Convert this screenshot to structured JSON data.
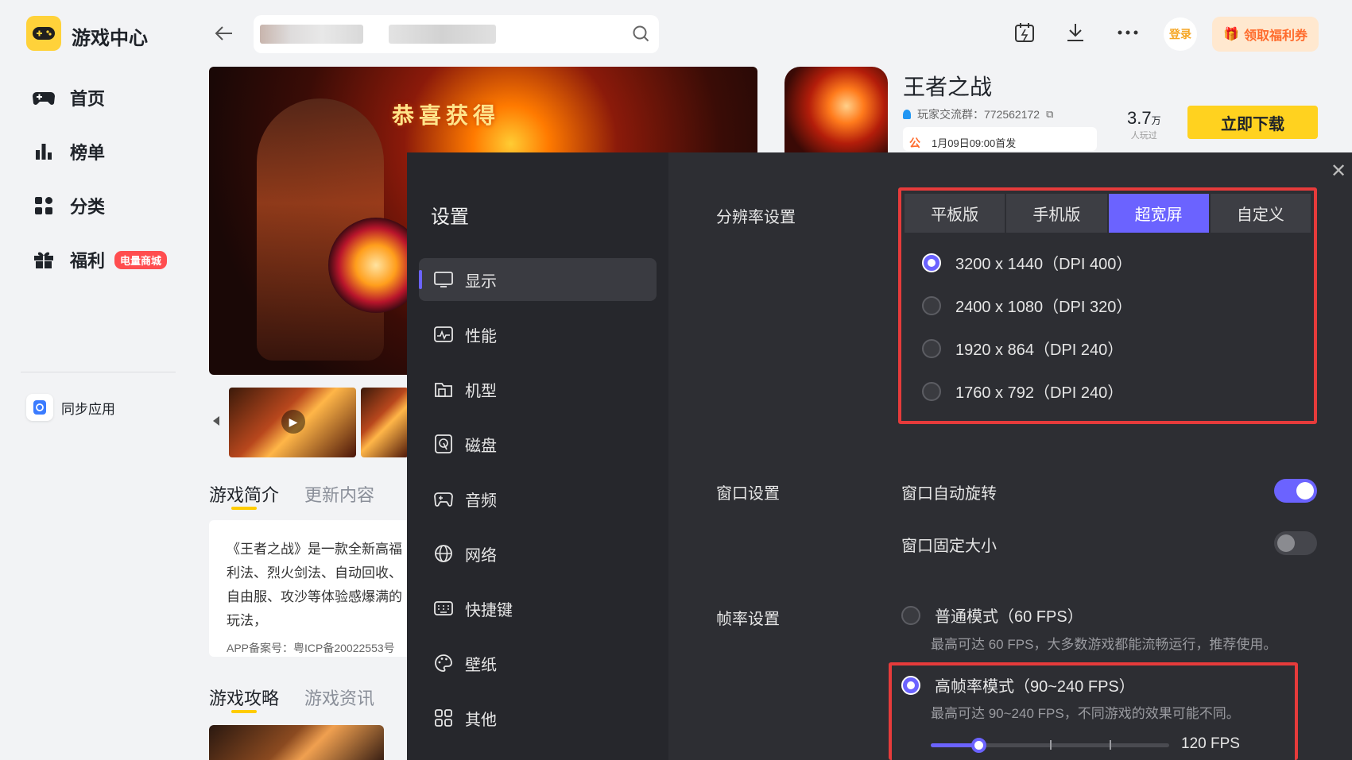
{
  "app": {
    "title": "游戏中心",
    "nav": [
      {
        "label": "首页",
        "icon": "gamepad-icon"
      },
      {
        "label": "榜单",
        "icon": "bar-chart-icon"
      },
      {
        "label": "分类",
        "icon": "grid-icon"
      },
      {
        "label": "福利",
        "icon": "gift-icon",
        "badge": "电量商城"
      }
    ],
    "sync_label": "同步应用",
    "login_label": "登录",
    "welfare_label": "领取福利券"
  },
  "game": {
    "banner_text": "恭喜获得",
    "name": "王者之战",
    "group": "玩家交流群：772562172",
    "notice_prefix": "公",
    "notice": "1月09日09:00首发",
    "players_num": "3.7",
    "players_unit": "万",
    "players_label": "人玩过",
    "download_label": "立即下载",
    "tabs": [
      "游戏简介",
      "更新内容"
    ],
    "desc": "《王者之战》是一款全新高福利法、烈火剑法、自动回收、自由服、攻沙等体验感爆满的玩法，",
    "icp": "APP备案号：粤ICP备20022553号",
    "tabs2": [
      "游戏攻略",
      "游戏资讯"
    ]
  },
  "settings": {
    "title": "设置",
    "menu": [
      {
        "label": "显示",
        "icon": "monitor-icon",
        "active": true
      },
      {
        "label": "性能",
        "icon": "performance-icon"
      },
      {
        "label": "机型",
        "icon": "device-model-icon"
      },
      {
        "label": "磁盘",
        "icon": "disk-icon"
      },
      {
        "label": "音频",
        "icon": "audio-icon"
      },
      {
        "label": "网络",
        "icon": "globe-icon"
      },
      {
        "label": "快捷键",
        "icon": "keyboard-icon"
      },
      {
        "label": "壁纸",
        "icon": "palette-icon"
      },
      {
        "label": "其他",
        "icon": "apps-icon"
      }
    ],
    "resolution": {
      "label": "分辨率设置",
      "tabs": [
        "平板版",
        "手机版",
        "超宽屏",
        "自定义"
      ],
      "active_tab": "超宽屏",
      "options": [
        "3200 x 1440（DPI 400）",
        "2400 x 1080（DPI 320）",
        "1920 x 864（DPI 240）",
        "1760 x 792（DPI 240）"
      ],
      "selected": "3200 x 1440（DPI 400）"
    },
    "window": {
      "label": "窗口设置",
      "auto_rotate": {
        "label": "窗口自动旋转",
        "on": true
      },
      "fixed_size": {
        "label": "窗口固定大小",
        "on": false
      }
    },
    "framerate": {
      "label": "帧率设置",
      "normal": {
        "label": "普通模式（60 FPS）",
        "desc": "最高可达 60 FPS，大多数游戏都能流畅运行，推荐使用。"
      },
      "high": {
        "label": "高帧率模式（90~240 FPS）",
        "desc": "最高可达 90~240 FPS，不同游戏的效果可能不同。"
      },
      "selected": "high",
      "slider_min": 90,
      "slider_max": 240,
      "slider_value": 120,
      "slider_value_label": "120 FPS"
    }
  },
  "colors": {
    "accent": "#6b63ff",
    "highlight": "#e63b3b",
    "download": "#ffd21f"
  }
}
